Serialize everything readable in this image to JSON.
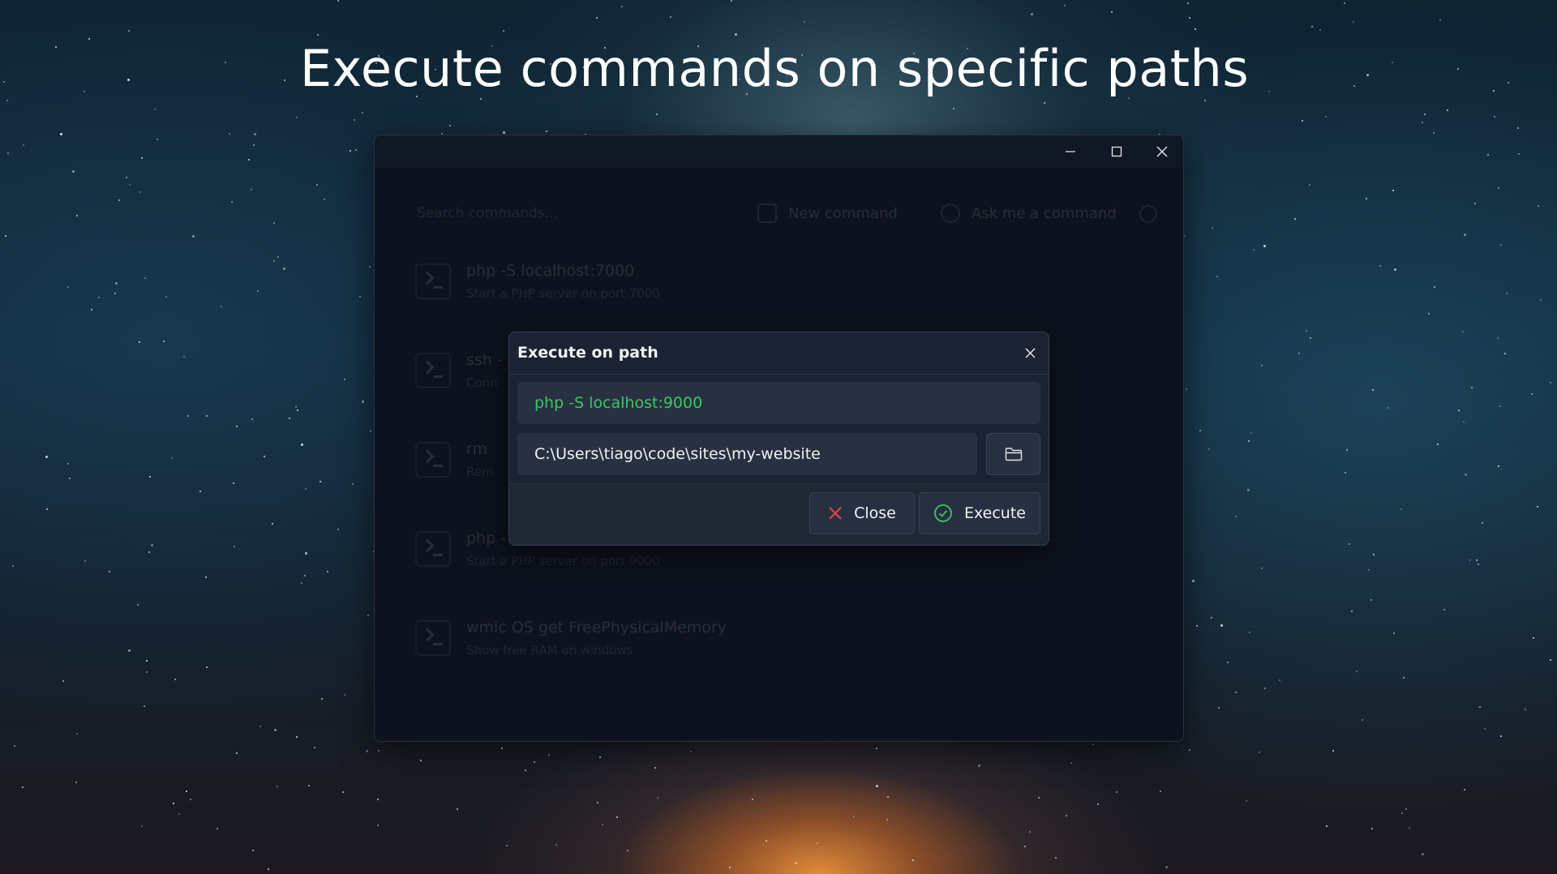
{
  "headline": "Execute commands on specific paths",
  "window": {
    "controls": {
      "minimize_icon": "minimize-icon",
      "maximize_icon": "maximize-icon",
      "close_icon": "close-icon"
    },
    "search": {
      "placeholder": "Search commands..."
    },
    "toolbar": {
      "new_command_label": "New command",
      "ask_command_label": "Ask me a command"
    },
    "commands": [
      {
        "title": "php -S localhost:7000",
        "description": "Start a PHP server on port 7000"
      },
      {
        "title": "ssh -",
        "description": "Conn"
      },
      {
        "title": "rm",
        "description": "Rem"
      },
      {
        "title": "php -",
        "description": "Start a PHP server on port 9000"
      },
      {
        "title": "wmic OS get FreePhysicalMemory",
        "description": "Show free RAM on windows"
      }
    ]
  },
  "dialog": {
    "title": "Execute on path",
    "command_value": "php -S localhost:9000",
    "path_value": "C:\\Users\\tiago\\code\\sites\\my-website",
    "close_label": "Close",
    "execute_label": "Execute"
  },
  "colors": {
    "accent_green": "#3dc75f",
    "close_red": "#e5484d",
    "dialog_bg": "#1b2332",
    "window_bg": "#101725"
  }
}
